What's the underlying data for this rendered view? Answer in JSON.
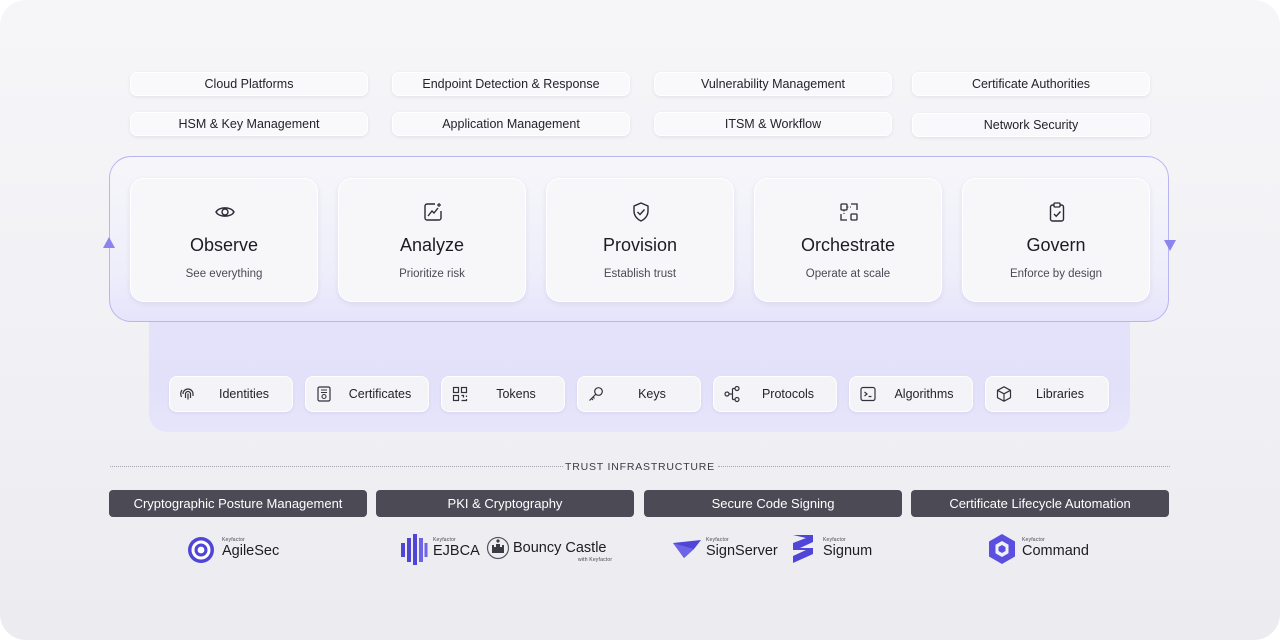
{
  "integrations": {
    "row1": [
      "Cloud Platforms",
      "Endpoint Detection & Response",
      "Vulnerability Management",
      "Certificate Authorities"
    ],
    "row2": [
      "HSM & Key Management",
      "Application Management",
      "ITSM & Workflow",
      "Network Security"
    ]
  },
  "lifecycle": [
    {
      "title": "Observe",
      "subtitle": "See everything",
      "icon": "eye-icon"
    },
    {
      "title": "Analyze",
      "subtitle": "Prioritize risk",
      "icon": "chart-sparkle-icon"
    },
    {
      "title": "Provision",
      "subtitle": "Establish trust",
      "icon": "shield-check-icon"
    },
    {
      "title": "Orchestrate",
      "subtitle": "Operate at scale",
      "icon": "nodes-icon"
    },
    {
      "title": "Govern",
      "subtitle": "Enforce by design",
      "icon": "clipboard-check-icon"
    }
  ],
  "assets": [
    {
      "label": "Identities",
      "icon": "fingerprint-icon"
    },
    {
      "label": "Certificates",
      "icon": "certificate-icon"
    },
    {
      "label": "Tokens",
      "icon": "qr-code-icon"
    },
    {
      "label": "Keys",
      "icon": "key-icon"
    },
    {
      "label": "Protocols",
      "icon": "share-nodes-icon"
    },
    {
      "label": "Algorithms",
      "icon": "terminal-icon"
    },
    {
      "label": "Libraries",
      "icon": "cube-icon"
    }
  ],
  "trust": {
    "title": "TRUST INFRASTRUCTURE",
    "categories": [
      "Cryptographic Posture Management",
      "PKI & Cryptography",
      "Secure Code Signing",
      "Certificate Lifecycle Automation"
    ]
  },
  "products": {
    "brand_small": "Keyfactor",
    "agilesec": "AgileSec",
    "ejbca": "EJBCA",
    "bouncy": "Bouncy Castle",
    "bouncy_sub": "with Keyfactor",
    "signserver": "SignServer",
    "signum": "Signum",
    "command": "Command"
  },
  "colors": {
    "accent": "#7c74ea",
    "loop_border": "#b9b5f2",
    "category_bg": "#4b4a55",
    "brand": "#5b4fe0"
  }
}
